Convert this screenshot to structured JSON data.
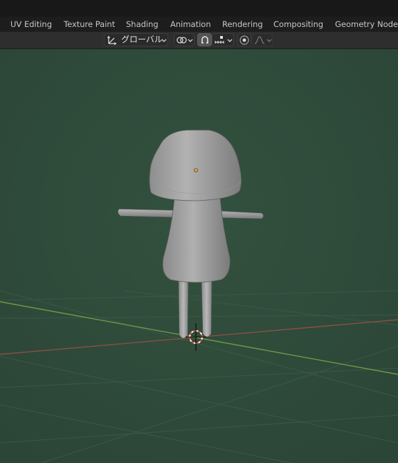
{
  "workspace_tabs": [
    {
      "label": "UV Editing"
    },
    {
      "label": "Texture Paint"
    },
    {
      "label": "Shading"
    },
    {
      "label": "Animation"
    },
    {
      "label": "Rendering"
    },
    {
      "label": "Compositing"
    },
    {
      "label": "Geometry Nodes"
    }
  ],
  "header": {
    "transform_orientation": "グローバル",
    "icons": {
      "orientation": "transform-orientation-icon",
      "pivot": "pivot-link-icon",
      "snap": "snap-magnet-icon",
      "snap_target": "snap-increment-icon",
      "proportional": "proportional-editing-icon",
      "falloff": "falloff-curve-icon"
    }
  },
  "colors": {
    "viewport_bg": "#2f4b3b",
    "x_axis": "#8a4f45",
    "y_axis": "#6f9a45",
    "origin_dot": "#f0a030"
  }
}
